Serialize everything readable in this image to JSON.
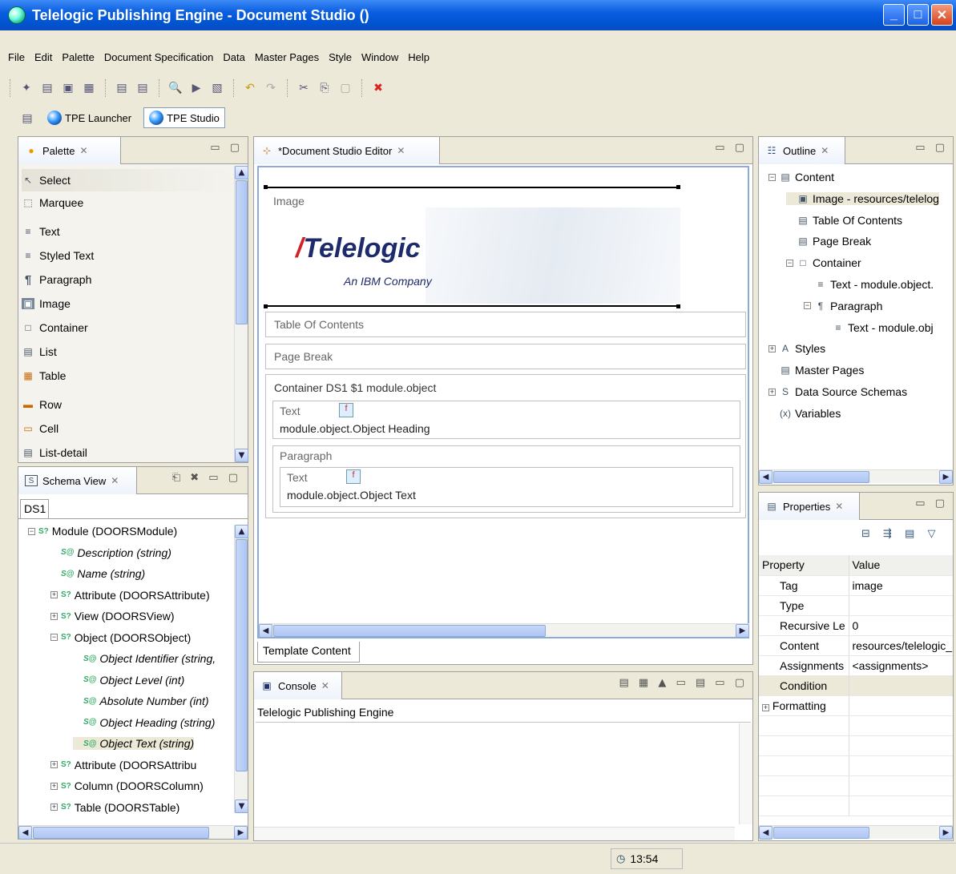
{
  "window": {
    "title": "Telelogic Publishing Engine - Document Studio ()"
  },
  "menu": [
    "File",
    "Edit",
    "Palette",
    "Document Specification",
    "Data",
    "Master Pages",
    "Style",
    "Window",
    "Help"
  ],
  "perspectives": {
    "launcher": "TPE Launcher",
    "studio": "TPE Studio"
  },
  "palette": {
    "title": "Palette",
    "items": [
      "Select",
      "Marquee",
      "Text",
      "Styled Text",
      "Paragraph",
      "Image",
      "Container",
      "List",
      "Table",
      "Row",
      "Cell",
      "List-detail"
    ]
  },
  "schema": {
    "title": "Schema View",
    "source": "DS1",
    "tree": [
      {
        "label": "Module (DOORSModule)",
        "italic": false
      },
      {
        "label": "Description (string)",
        "italic": true
      },
      {
        "label": "Name (string)",
        "italic": true
      },
      {
        "label": "Attribute (DOORSAttribute)",
        "italic": false
      },
      {
        "label": "View (DOORSView)",
        "italic": false
      },
      {
        "label": "Object (DOORSObject)",
        "italic": false
      },
      {
        "label": "Object Identifier (string,",
        "italic": true
      },
      {
        "label": "Object Level (int)",
        "italic": true
      },
      {
        "label": "Absolute Number (int)",
        "italic": true
      },
      {
        "label": "Object Heading (string)",
        "italic": true
      },
      {
        "label": "Object Text (string)",
        "italic": true
      },
      {
        "label": "Attribute (DOORSAttribu",
        "italic": false
      },
      {
        "label": "Column (DOORSColumn)",
        "italic": false
      },
      {
        "label": "Table (DOORSTable)",
        "italic": false
      }
    ]
  },
  "editor": {
    "title": "*Document Studio Editor",
    "image_label": "Image",
    "logo_text": "Telelogic",
    "logo_sub": "An IBM Company",
    "toc": "Table Of Contents",
    "page_break": "Page Break",
    "container": "Container DS1   $1   module.object",
    "text1_label": "Text",
    "text1_value": "module.object.Object Heading",
    "paragraph": "Paragraph",
    "text2_label": "Text",
    "text2_value": "module.object.Object Text",
    "bottom_tab": "Template Content"
  },
  "console": {
    "title": "Console",
    "header": "Telelogic Publishing Engine"
  },
  "outline": {
    "title": "Outline",
    "tree": [
      "Content",
      "Image - resources/telelog",
      "Table Of Contents",
      "Page Break",
      "Container",
      "Text - module.object.",
      "Paragraph",
      "Text - module.obj",
      "Styles",
      "Master Pages",
      "Data Source Schemas",
      "Variables"
    ]
  },
  "properties": {
    "title": "Properties",
    "columns": [
      "Property",
      "Value"
    ],
    "rows": [
      [
        "Tag",
        "image"
      ],
      [
        "Type",
        ""
      ],
      [
        "Recursive Le",
        "0"
      ],
      [
        "Content",
        "resources/telelogic_"
      ],
      [
        "Assignments",
        "<assignments>"
      ],
      [
        "Condition",
        ""
      ],
      [
        "Formatting",
        ""
      ]
    ]
  },
  "status": {
    "time": "13:54"
  }
}
